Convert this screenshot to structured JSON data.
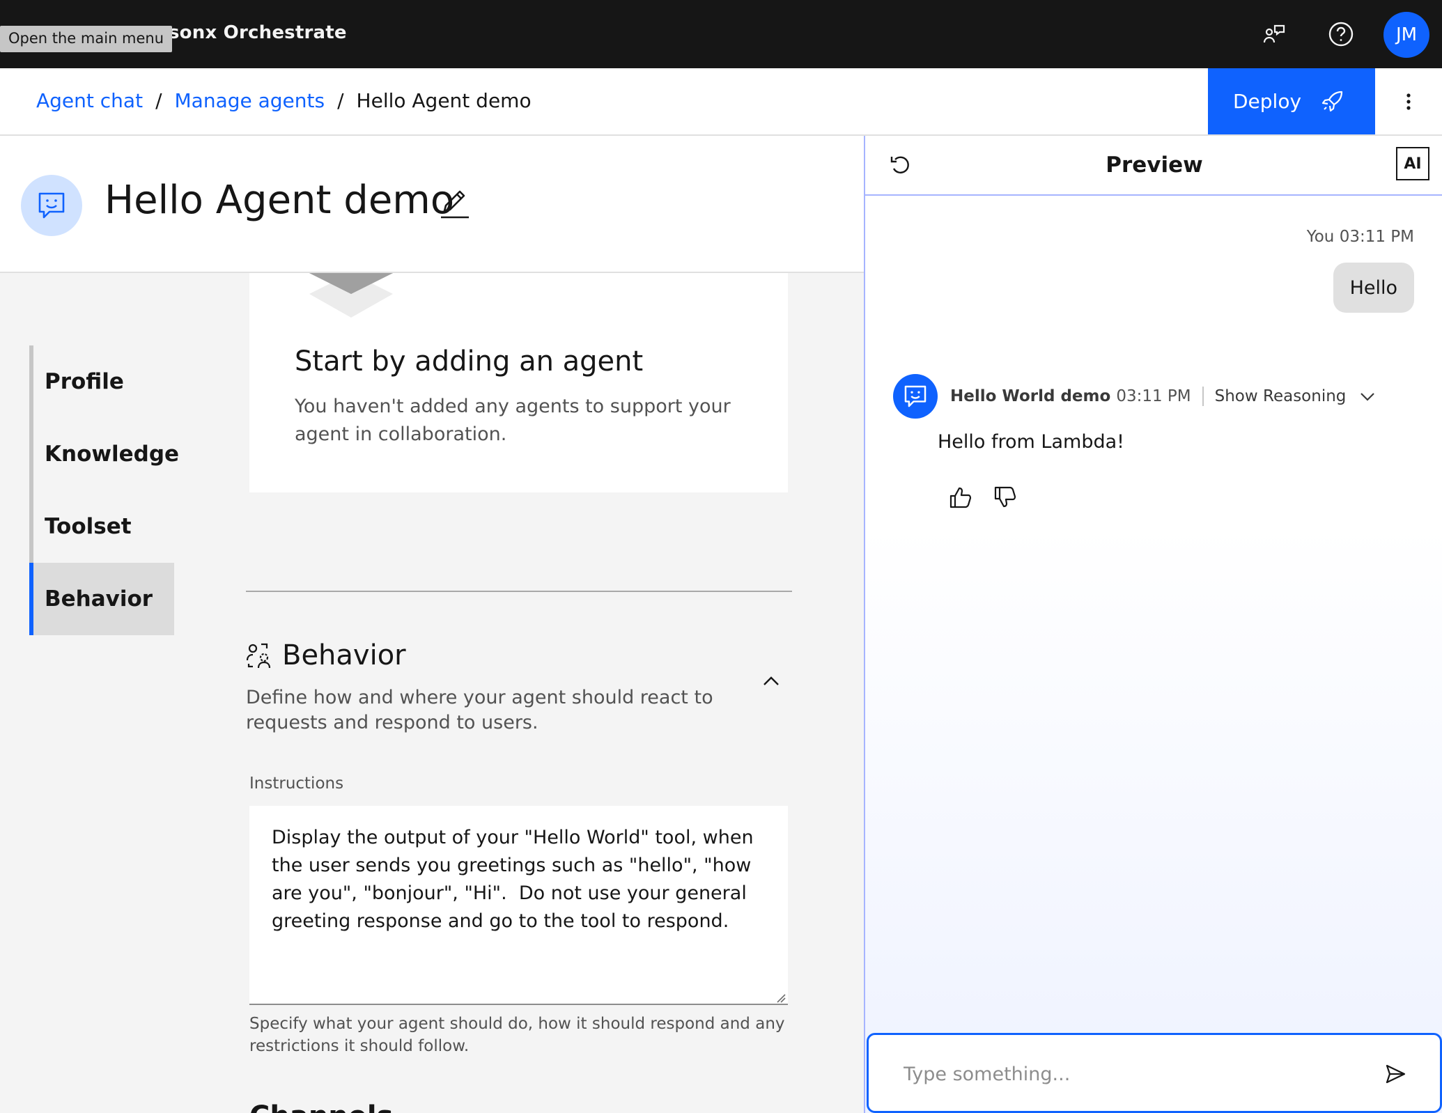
{
  "header": {
    "app_title": "sonx Orchestrate",
    "tooltip": "Open the main menu",
    "avatar_initials": "JM"
  },
  "breadcrumb": {
    "items": [
      "Agent chat",
      "Manage agents",
      "Hello Agent demo"
    ],
    "separator": "/"
  },
  "toolbar": {
    "deploy_label": "Deploy"
  },
  "agent": {
    "title": "Hello Agent demo"
  },
  "nav": {
    "items": [
      "Profile",
      "Knowledge",
      "Toolset",
      "Behavior"
    ],
    "active": "Behavior"
  },
  "collaborators_card": {
    "title": "Start by adding an agent",
    "description": "You haven't added any agents to support your agent in collaboration."
  },
  "behavior": {
    "title": "Behavior",
    "description": "Define how and where your agent should react to requests and respond to users.",
    "instructions_label": "Instructions",
    "instructions_value": "Display the output of your \"Hello World\" tool, when the user sends you greetings such as \"hello\", \"how are you\", \"bonjour\", \"Hi\".  Do not use your general greeting response and go to the tool to respond.",
    "helper_text": "Specify what your agent should do, how it should respond and any restrictions it should follow.",
    "next_section": "Channels"
  },
  "preview": {
    "title": "Preview",
    "ai_badge": "AI",
    "user_message": {
      "meta": "You 03:11 PM",
      "text": "Hello"
    },
    "bot_message": {
      "name": "Hello World demo",
      "time": "03:11 PM",
      "reasoning_label": "Show Reasoning",
      "text": "Hello from Lambda!"
    },
    "input_placeholder": "Type something..."
  },
  "colors": {
    "accent": "#0f62fe",
    "header_bg": "#161616",
    "preview_border": "#a6b4ff"
  }
}
